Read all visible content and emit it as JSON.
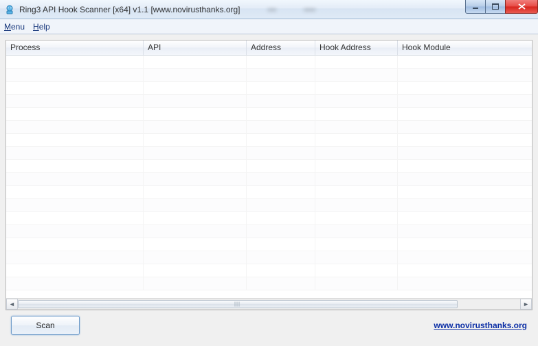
{
  "window": {
    "title": "Ring3 API Hook Scanner [x64] v1.1 [www.novirusthanks.org]"
  },
  "menu": {
    "menu_label": "Menu",
    "help_label": "Help"
  },
  "table": {
    "columns": [
      "Process",
      "API",
      "Address",
      "Hook Address",
      "Hook Module"
    ],
    "rows": []
  },
  "footer": {
    "scan_label": "Scan",
    "link_text": "www.novirusthanks.org"
  }
}
